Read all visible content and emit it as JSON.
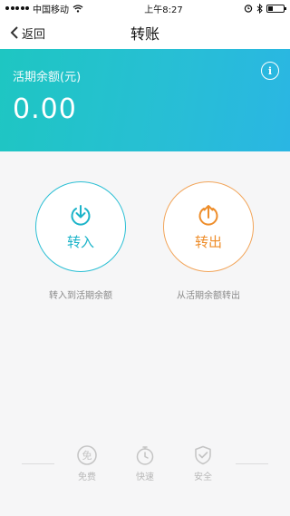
{
  "status_bar": {
    "carrier": "中国移动",
    "time": "上午8:27"
  },
  "nav": {
    "back_label": "返回",
    "title": "转账"
  },
  "balance": {
    "label": "活期余额(元)",
    "amount": "0.00",
    "info_icon": "info-icon"
  },
  "actions": {
    "transfer_in": {
      "label": "转入",
      "description": "转入到活期余额",
      "icon": "download-icon",
      "color": "#1cb4c9"
    },
    "transfer_out": {
      "label": "转出",
      "description": "从活期余额转出",
      "icon": "upload-icon",
      "color": "#ee8d2a"
    }
  },
  "features": [
    {
      "label": "免费",
      "icon": "free-badge-icon"
    },
    {
      "label": "快速",
      "icon": "stopwatch-icon"
    },
    {
      "label": "安全",
      "icon": "shield-check-icon"
    }
  ],
  "colors": {
    "card_gradient_start": "#1ec6c2",
    "card_gradient_end": "#2ab6e3",
    "background": "#f6f6f7"
  }
}
